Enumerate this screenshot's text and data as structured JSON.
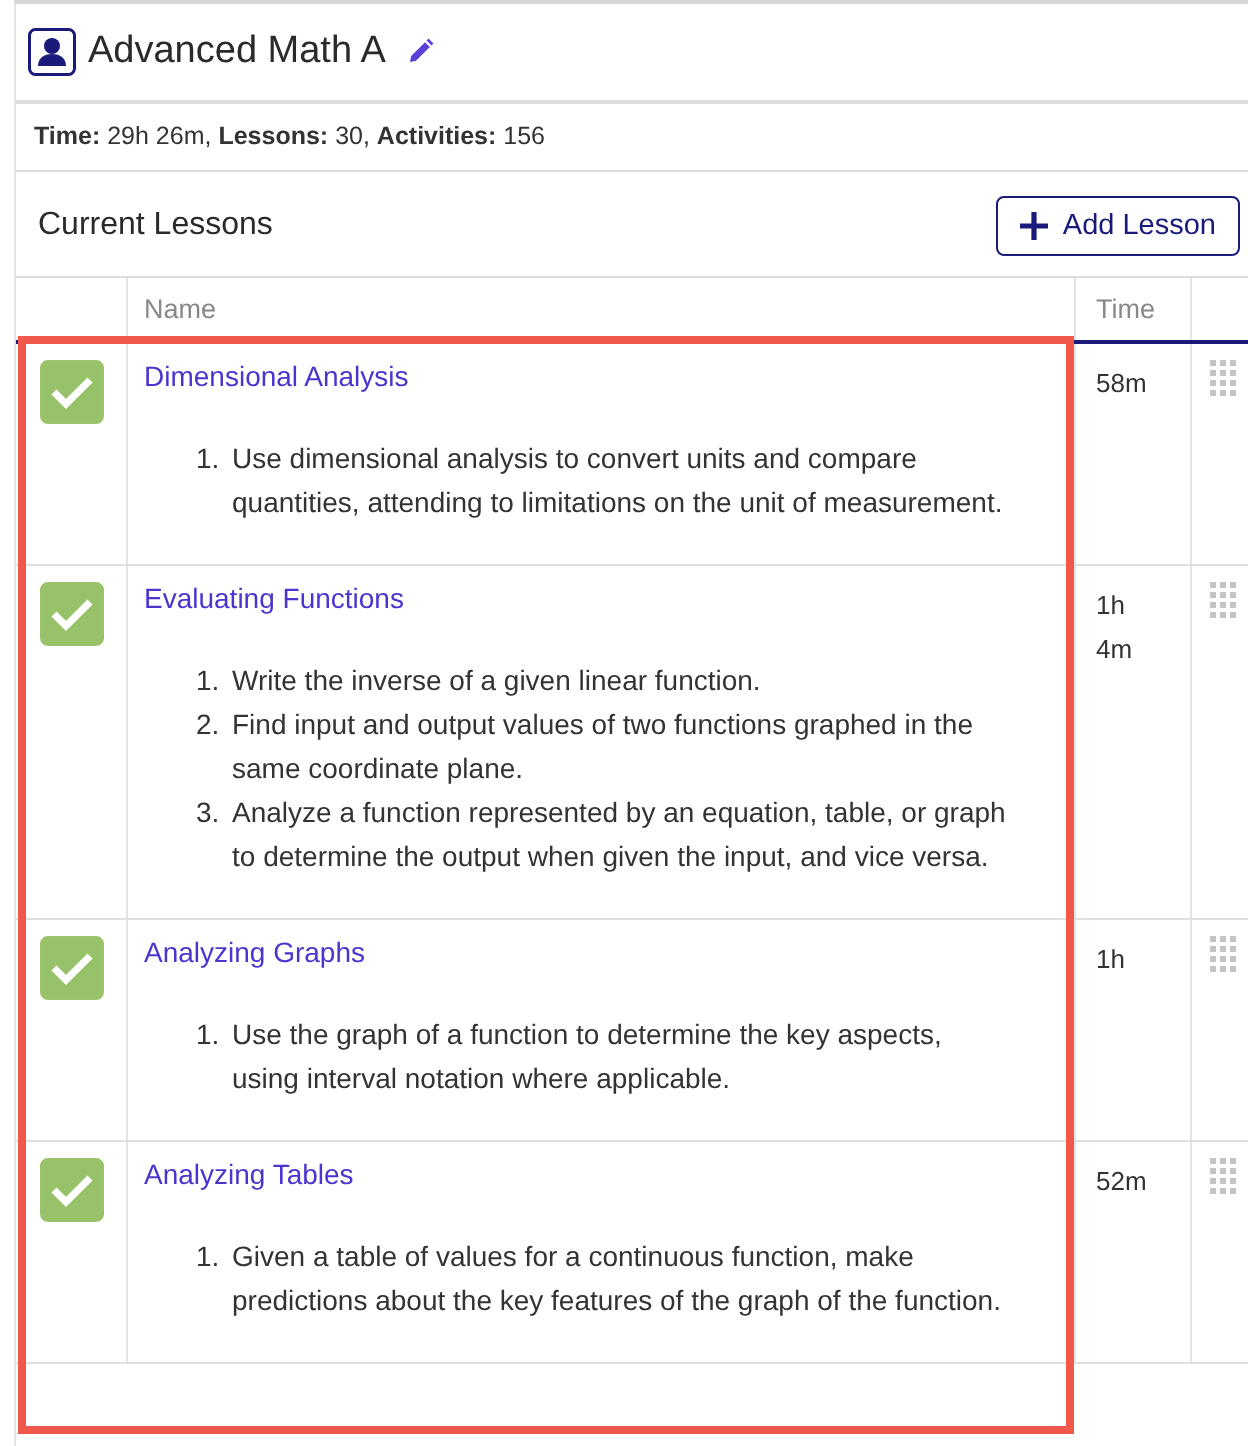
{
  "course": {
    "title": "Advanced Math A"
  },
  "summary": [
    {
      "label": "Time:",
      "value": "29h 26m,"
    },
    {
      "label": "Lessons:",
      "value": "30,"
    },
    {
      "label": "Activities:",
      "value": "156"
    }
  ],
  "section": {
    "title": "Current Lessons",
    "add_button": "Add Lesson"
  },
  "table": {
    "columns": [
      "Name",
      "Time"
    ],
    "rows": [
      {
        "checked": true,
        "name": "Dimensional Analysis",
        "time": "58m",
        "objectives": [
          {
            "number": "1.",
            "text": "Use dimensional analysis to convert units and compare quantities, attending to limitations on the unit of measurement."
          }
        ]
      },
      {
        "checked": true,
        "name": "Evaluating Functions",
        "time": "1h 4m",
        "objectives": [
          {
            "number": "1.",
            "text": "Write the inverse of a given linear function."
          },
          {
            "number": "2.",
            "text": "Find input and output values of two functions graphed in the same coordinate plane."
          },
          {
            "number": "3.",
            "text": "Analyze a function represented by an equation, table, or graph to determine the output when given the input, and vice versa."
          }
        ]
      },
      {
        "checked": true,
        "name": "Analyzing Graphs",
        "time": "1h",
        "objectives": [
          {
            "number": "1.",
            "text": "Use the graph of a function to determine the key aspects, using interval notation where applicable."
          }
        ]
      },
      {
        "checked": true,
        "name": "Analyzing Tables",
        "time": "52m",
        "objectives": [
          {
            "number": "1.",
            "text": "Given a table of values for a continuous function, make predictions about the key features of the graph of the function."
          }
        ]
      }
    ]
  },
  "highlight": {
    "shown": true
  }
}
